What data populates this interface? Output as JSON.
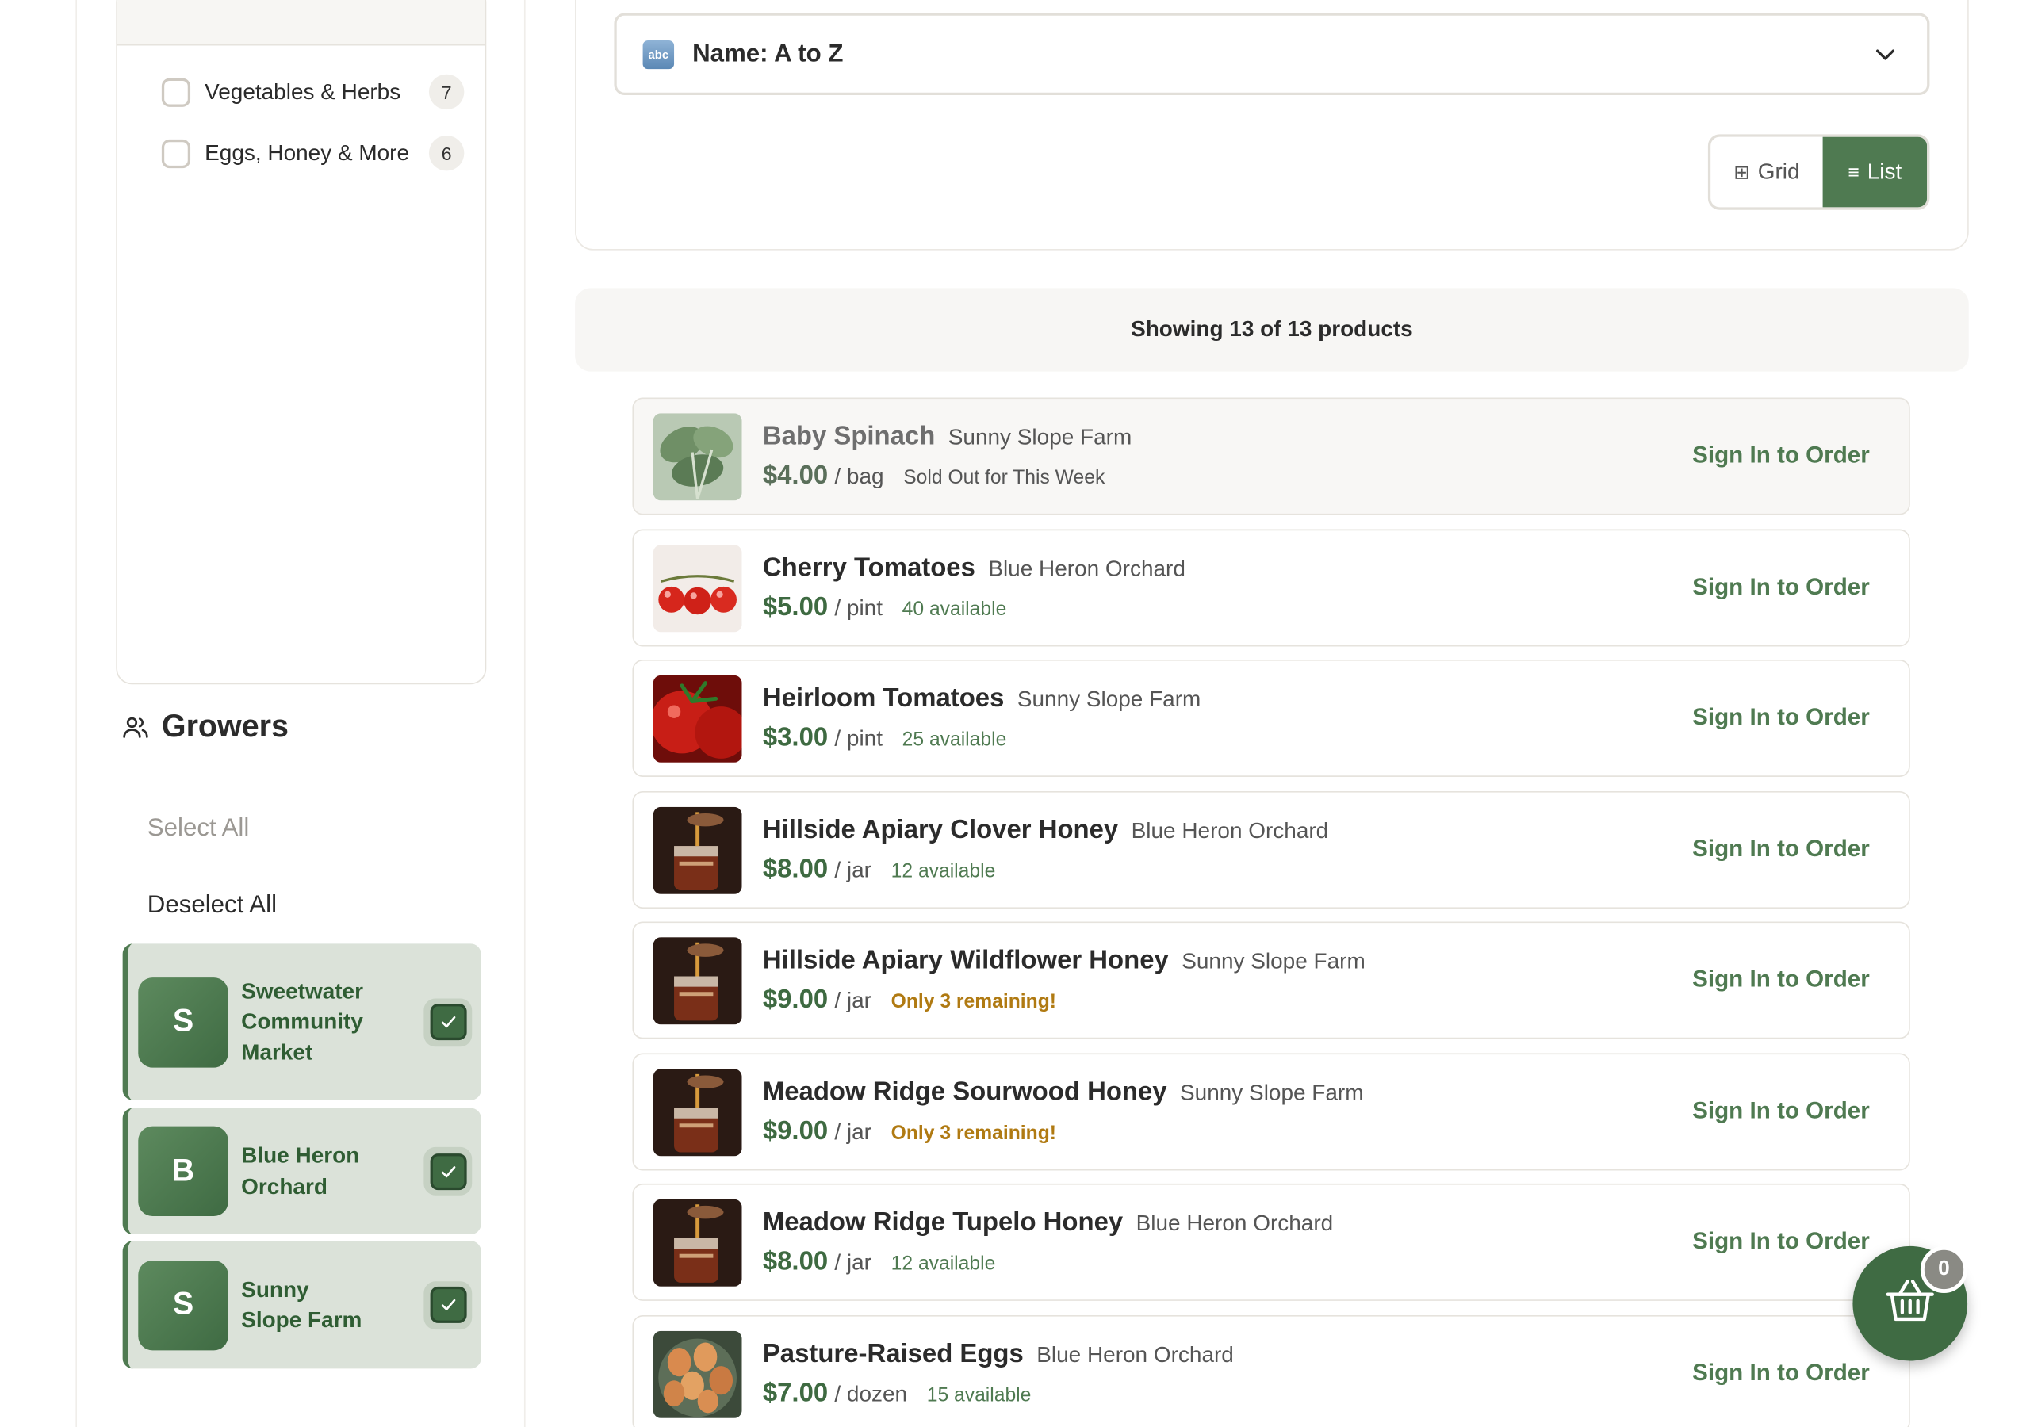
{
  "categories": {
    "items": [
      {
        "label": "Vegetables & Herbs",
        "count": "7"
      },
      {
        "label": "Eggs, Honey & More",
        "count": "6"
      }
    ]
  },
  "growers": {
    "title": "Growers",
    "select_all": "Select All",
    "deselect_all": "Deselect All",
    "items": [
      {
        "initial": "S",
        "name": "Sweetwater Community Market"
      },
      {
        "initial": "B",
        "name": "Blue Heron Orchard"
      },
      {
        "initial": "S",
        "name": "Sunny Slope Farm"
      }
    ]
  },
  "sort": {
    "icon_text": "abc",
    "label": "Name: A to Z"
  },
  "view_toggle": {
    "grid_label": "Grid",
    "list_label": "List"
  },
  "summary": {
    "showing": "Showing 13 of 13 products"
  },
  "products": [
    {
      "name": "Baby Spinach",
      "farm": "Sunny Slope Farm",
      "price": "$4.00",
      "unit": "/ bag",
      "availability": "Sold Out for This Week",
      "action": "Sign In to Order"
    },
    {
      "name": "Cherry Tomatoes",
      "farm": "Blue Heron Orchard",
      "price": "$5.00",
      "unit": "/ pint",
      "availability": "40 available",
      "action": "Sign In to Order"
    },
    {
      "name": "Heirloom Tomatoes",
      "farm": "Sunny Slope Farm",
      "price": "$3.00",
      "unit": "/ pint",
      "availability": "25 available",
      "action": "Sign In to Order"
    },
    {
      "name": "Hillside Apiary Clover Honey",
      "farm": "Blue Heron Orchard",
      "price": "$8.00",
      "unit": "/ jar",
      "availability": "12 available",
      "action": "Sign In to Order"
    },
    {
      "name": "Hillside Apiary Wildflower Honey",
      "farm": "Sunny Slope Farm",
      "price": "$9.00",
      "unit": "/ jar",
      "availability": "Only 3 remaining!",
      "action": "Sign In to Order"
    },
    {
      "name": "Meadow Ridge Sourwood Honey",
      "farm": "Sunny Slope Farm",
      "price": "$9.00",
      "unit": "/ jar",
      "availability": "Only 3 remaining!",
      "action": "Sign In to Order"
    },
    {
      "name": "Meadow Ridge Tupelo Honey",
      "farm": "Blue Heron Orchard",
      "price": "$8.00",
      "unit": "/ jar",
      "availability": "12 available",
      "action": "Sign In to Order"
    },
    {
      "name": "Pasture-Raised Eggs",
      "farm": "Blue Heron Orchard",
      "price": "$7.00",
      "unit": "/ dozen",
      "availability": "15 available",
      "action": "Sign In to Order"
    }
  ],
  "cart": {
    "count": "0"
  },
  "colors": {
    "brand_green": "#4f7a51",
    "low_stock": "#b07a12",
    "grower_bg": "#dbe2d9"
  }
}
